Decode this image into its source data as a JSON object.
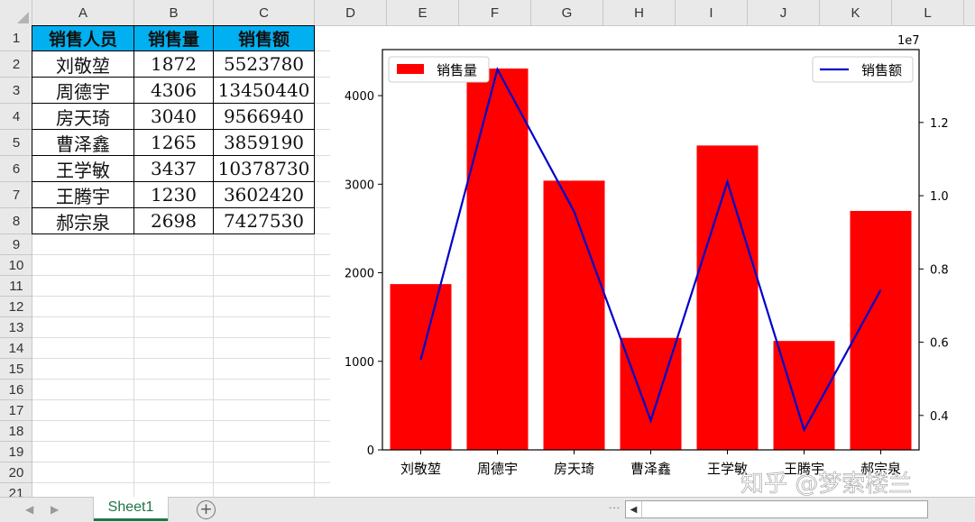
{
  "columns": [
    "A",
    "B",
    "C",
    "D",
    "E",
    "F",
    "G",
    "H",
    "I",
    "J",
    "K",
    "L"
  ],
  "rows": [
    "1",
    "2",
    "3",
    "4",
    "5",
    "6",
    "7",
    "8",
    "9",
    "10",
    "11",
    "12",
    "13",
    "14",
    "15",
    "16",
    "17",
    "18",
    "19",
    "20",
    "21"
  ],
  "table": {
    "headers": [
      "销售人员",
      "销售量",
      "销售额"
    ],
    "rows": [
      [
        "刘敬堃",
        "1872",
        "5523780"
      ],
      [
        "周德宇",
        "4306",
        "13450440"
      ],
      [
        "房天琦",
        "3040",
        "9566940"
      ],
      [
        "曹泽鑫",
        "1265",
        "3859190"
      ],
      [
        "王学敏",
        "3437",
        "10378730"
      ],
      [
        "王腾宇",
        "1230",
        "3602420"
      ],
      [
        "郝宗泉",
        "2698",
        "7427530"
      ]
    ],
    "header_color": "#00b0f0"
  },
  "chart_data": {
    "type": "bar",
    "categories": [
      "刘敬堃",
      "周德宇",
      "房天琦",
      "曹泽鑫",
      "王学敏",
      "王腾宇",
      "郝宗泉"
    ],
    "series": [
      {
        "name": "销售量",
        "type": "bar",
        "axis": "left",
        "color": "#ff0000",
        "values": [
          1872,
          4306,
          3040,
          1265,
          3437,
          1230,
          2698
        ]
      },
      {
        "name": "销售额",
        "type": "line",
        "axis": "right",
        "color": "#0000cc",
        "values": [
          5523780,
          13450440,
          9566940,
          3859190,
          10378730,
          3602420,
          7427530
        ]
      }
    ],
    "y_left": {
      "ticks": [
        "0",
        "1000",
        "2000",
        "3000",
        "4000"
      ],
      "lim": [
        0,
        4520
      ]
    },
    "y_right": {
      "ticks": [
        "0.4",
        "0.6",
        "0.8",
        "1.0",
        "1.2"
      ],
      "tick_values": [
        4000000,
        6000000,
        8000000,
        10000000,
        12000000
      ],
      "lim": [
        3060000,
        13990000
      ],
      "offset_label": "1e7"
    },
    "legend_left": "top-left",
    "legend_right": "top-right",
    "grid": false
  },
  "watermark": "知乎 @梦索楼兰",
  "tabs": {
    "sheet_name": "Sheet1",
    "add_label": "+",
    "prev_arrow": "◀",
    "next_arrow": "▶",
    "scroll_left": "◀"
  }
}
